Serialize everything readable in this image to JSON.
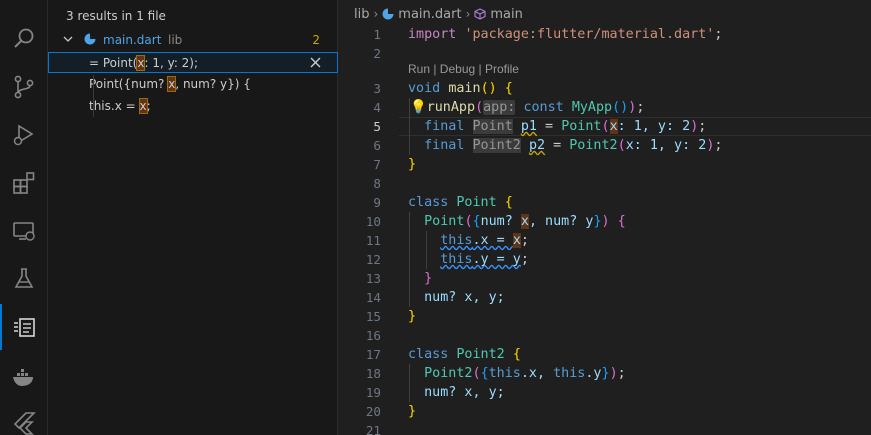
{
  "activity": [
    {
      "name": "search-icon"
    },
    {
      "name": "source-control-icon"
    },
    {
      "name": "run-debug-icon"
    },
    {
      "name": "extensions-icon"
    },
    {
      "name": "remote-explorer-icon"
    },
    {
      "name": "testing-icon"
    },
    {
      "name": "references-icon"
    },
    {
      "name": "docker-icon"
    },
    {
      "name": "flutter-icon"
    }
  ],
  "search": {
    "summary": "3 results in 1 file",
    "file": {
      "name": "main.dart",
      "dir": "lib",
      "count": "2"
    },
    "matches": [
      {
        "pre": "= Point(",
        "hit": "x",
        "post": ": 1, y: 2);"
      },
      {
        "pre": "Point({num? ",
        "hit": "x",
        "post": ", num? y}) {"
      },
      {
        "pre": "this.x = ",
        "hit": "x",
        "post": ";"
      }
    ]
  },
  "breadcrumbs": {
    "folder": "lib",
    "file": "main.dart",
    "symbol": "main"
  },
  "editor": {
    "codelens": "Run | Debug | Profile",
    "line_numbers": [
      "1",
      "2",
      "3",
      "4",
      "5",
      "6",
      "7",
      "8",
      "9",
      "10",
      "11",
      "12",
      "13",
      "14",
      "15",
      "16",
      "17",
      "18",
      "19",
      "20",
      "21"
    ],
    "current_line": "5"
  },
  "code": {
    "l1": {
      "kw": "import",
      "str": "'package:flutter/material.dart'",
      "end": ";"
    },
    "l3": {
      "type": "void",
      "fn": "main",
      "p": "()",
      "b": "{"
    },
    "l4": {
      "fn": "runApp",
      "o": "(",
      "hint": "app:",
      "kw": "const",
      "cls": "MyApp",
      "p": "()",
      "c": ")",
      "end": ";"
    },
    "l5": {
      "kw": "final",
      "th": "Point",
      "var": "p1",
      "eq": " = ",
      "cls": "Point",
      "o": "(",
      "x": "x",
      "rest": ": 1, y: 2",
      "c": ")",
      "end": ";"
    },
    "l6": {
      "kw": "final",
      "th": "Point2",
      "var": "p2",
      "eq": " = ",
      "cls": "Point2",
      "o": "(",
      "rest": "x: 1, y: 2",
      "c": ")",
      "end": ";"
    },
    "l7": {
      "b": "}"
    },
    "l9": {
      "kw": "class",
      "cls": "Point",
      "b": "{"
    },
    "l10": {
      "cls": "Point",
      "o": "(",
      "ob": "{",
      "p1": "num? ",
      "x": "x",
      "mid": ", num? y",
      "cb": "}",
      "c": ")",
      "b": "{"
    },
    "l11": {
      "this": "this",
      "rest": ".x = ",
      "x": "x",
      "end": ";"
    },
    "l12": {
      "this": "this",
      "rest": ".y = y",
      "end": ";"
    },
    "l13": {
      "b": "}"
    },
    "l14": {
      "text": "num? x, y;"
    },
    "l15": {
      "b": "}"
    },
    "l17": {
      "kw": "class",
      "cls": "Point2",
      "b": "{"
    },
    "l18": {
      "cls": "Point2",
      "o": "(",
      "ob": "{",
      "this1": "this",
      "m1": ".x, ",
      "this2": "this",
      "m2": ".y",
      "cb": "}",
      "c": ")",
      "end": ";"
    },
    "l19": {
      "text": "num? x, y;"
    },
    "l20": {
      "b": "}"
    }
  },
  "colors": {
    "accent": "#0078d4",
    "match": "#623315",
    "count": "#cca700"
  }
}
